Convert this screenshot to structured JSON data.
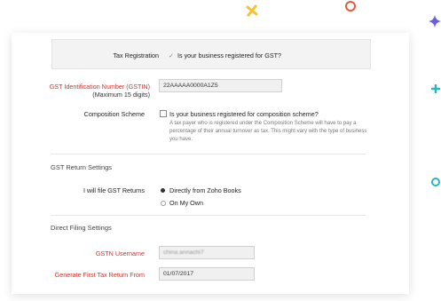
{
  "tax_registration": {
    "label": "Tax Registration",
    "check_mark": "✓",
    "question": "Is your business registered for GST?"
  },
  "gstin": {
    "label": "GST Identification Number (GSTIN)",
    "hint": "(Maximum 15 digits)",
    "value": "22AAAAA0000A1Z5"
  },
  "composition": {
    "label": "Composition Scheme",
    "question": "Is your business registered for composition scheme?",
    "description_line1": "A tax payer who is registered under the Composition Scheme will have to pay a",
    "description_line2": "percentage of their annual turnover as tax. This might vary with the type of business",
    "description_line3": "you have."
  },
  "gst_return_settings": {
    "heading": "GST Return Settings",
    "label": "I will file GST Returns",
    "option_selected": "Directly from Zoho Books",
    "option_other": "On My Own"
  },
  "direct_filing": {
    "heading": "Direct Filing Settings",
    "username_label": "GSTN Username",
    "username_value": "china.annachi7",
    "first_return_label": "Generate First Tax Return From",
    "first_return_value": "01/07/2017"
  },
  "colors": {
    "required_label": "#d0332a",
    "deco_yellow": "#f2c230",
    "deco_orange": "#e45a3c",
    "deco_purple": "#6b5ce0",
    "deco_teal": "#2bb3c0"
  }
}
